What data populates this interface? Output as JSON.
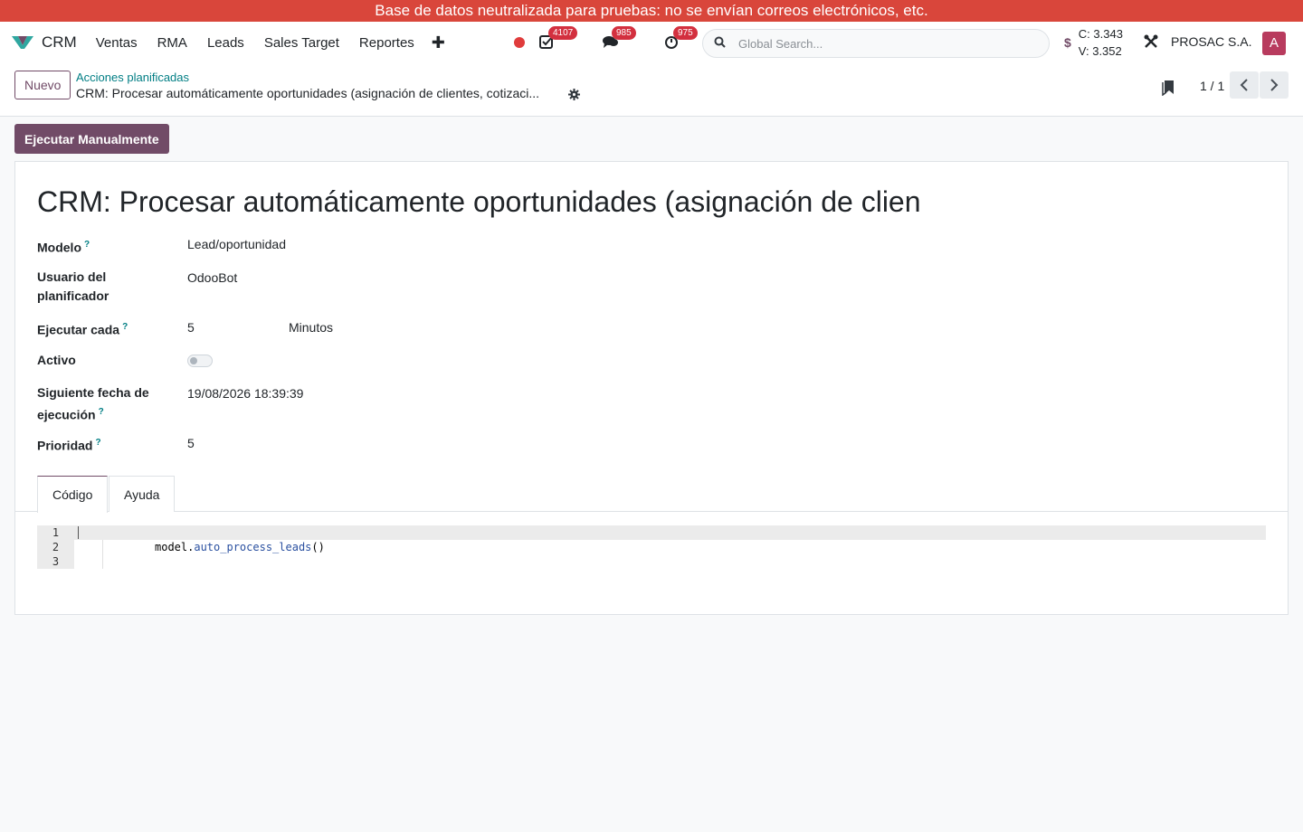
{
  "banner": {
    "text": "Base de datos neutralizada para pruebas: no se envían correos electrónicos, etc."
  },
  "navbar": {
    "app_name": "CRM",
    "menu": [
      "Ventas",
      "RMA",
      "Leads",
      "Sales Target",
      "Reportes"
    ],
    "plus_label": "✚",
    "badges": {
      "activities": "4107",
      "messages": "985",
      "timer": "975"
    },
    "search_placeholder": "Global Search...",
    "currency_symbol": "$",
    "rate_c": "C: 3.343",
    "rate_v": "V: 3.352",
    "company": "PROSAC S.A.",
    "avatar_letter": "A",
    "colors": {
      "brand": "#714b67",
      "banner": "#d9463b",
      "badge": "#d3303f",
      "link": "#017e84"
    }
  },
  "control_panel": {
    "new_label": "Nuevo",
    "breadcrumb_parent": "Acciones planificadas",
    "breadcrumb_current": "CRM: Procesar automáticamente oportunidades (asignación de clientes, cotizaci...",
    "pager": "1 / 1"
  },
  "form": {
    "exec_button": "Ejecutar Manualmente",
    "title": "CRM: Procesar automáticamente oportunidades (asignación de clien",
    "fields": {
      "model_label": "Modelo",
      "model_value": "Lead/oportunidad",
      "user_label": "Usuario del planificador",
      "user_value": "OdooBot",
      "interval_label": "Ejecutar cada",
      "interval_number": "5",
      "interval_unit": "Minutos",
      "active_label": "Activo",
      "active_value": false,
      "nextcall_label": "Siguiente fecha de ejecución",
      "nextcall_value": "19/08/2026 18:39:39",
      "priority_label": "Prioridad",
      "priority_value": "5",
      "help_mark": "?"
    },
    "tabs": [
      "Código",
      "Ayuda"
    ],
    "code": {
      "line_numbers": [
        "1",
        "2",
        "3"
      ],
      "object": "model",
      "dot": ".",
      "method": "auto_process_leads",
      "parens": "()"
    }
  }
}
